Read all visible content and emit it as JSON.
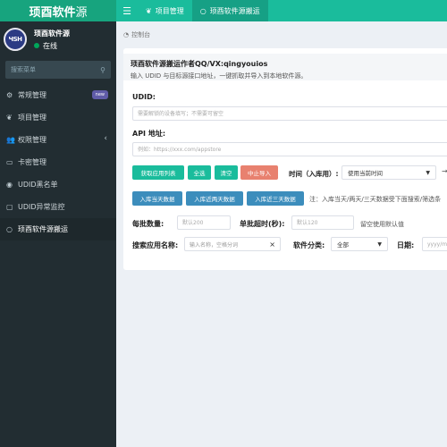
{
  "header": {
    "logo_bold": "顼酉软件",
    "logo_thin": "源",
    "menu_icon": "bars-icon",
    "tabs": [
      {
        "label": "项目管理",
        "icon": "leaf-icon"
      },
      {
        "label": "顼酉软件源搬运",
        "icon": "circle-icon"
      }
    ]
  },
  "sidebar": {
    "avatar_text": "ЧSH",
    "user_name": "顼酉软件源",
    "status": "在线",
    "status_color": "#00a65a",
    "search_placeholder": "搜索菜单",
    "items": [
      {
        "label": "常规管理",
        "icon": "gears-icon",
        "badge": "new"
      },
      {
        "label": "项目管理",
        "icon": "leaf-icon"
      },
      {
        "label": "权限管理",
        "icon": "group-icon",
        "arrow": "‹"
      },
      {
        "label": "卡密管理",
        "icon": "card-icon"
      },
      {
        "label": "UDID黑名单",
        "icon": "user-circle-icon"
      },
      {
        "label": "UDID异常监控",
        "icon": "monitor-icon"
      },
      {
        "label": "顼酉软件源搬运",
        "icon": "circle-icon"
      }
    ]
  },
  "breadcrumb": {
    "label": "控制台",
    "icon": "dashboard-icon"
  },
  "notice": {
    "title": "顼酉软件源搬运作者QQ/VX:qingyouios",
    "text": "输入 UDID 与目标源接口地址，一键抓取并导入到本地软件源。"
  },
  "form": {
    "udid_label": "UDID:",
    "udid_placeholder": "需要解锁的设备填写；不需要可留空",
    "api_label": "API 地址:",
    "api_placeholder": "例如：https://xxx.com/appstore",
    "buttons": {
      "fetch": "获取应用列表",
      "select_all": "全选",
      "clear": "清空",
      "stop": "中止导入"
    },
    "time_label": "时间（入库用）:",
    "time_select": "使用当前时间",
    "batch_buttons": {
      "today": "入库当天数据",
      "two_days": "入库近两天数据",
      "three_days": "入库近三天数据"
    },
    "batch_note": "注：入库当天/两天/三天数据受下面搜索/筛选条",
    "batch_size_label": "每批数量:",
    "batch_size_placeholder": "默认200",
    "timeout_label": "单批超时(秒):",
    "timeout_placeholder": "默认120",
    "default_note": "留空使用默认值",
    "search_label": "搜索应用名称:",
    "search_placeholder": "输入名称，空格分词",
    "category_label": "软件分类:",
    "category_value": "全部",
    "date_label": "日期:",
    "date_placeholder": "yyyy/m"
  }
}
